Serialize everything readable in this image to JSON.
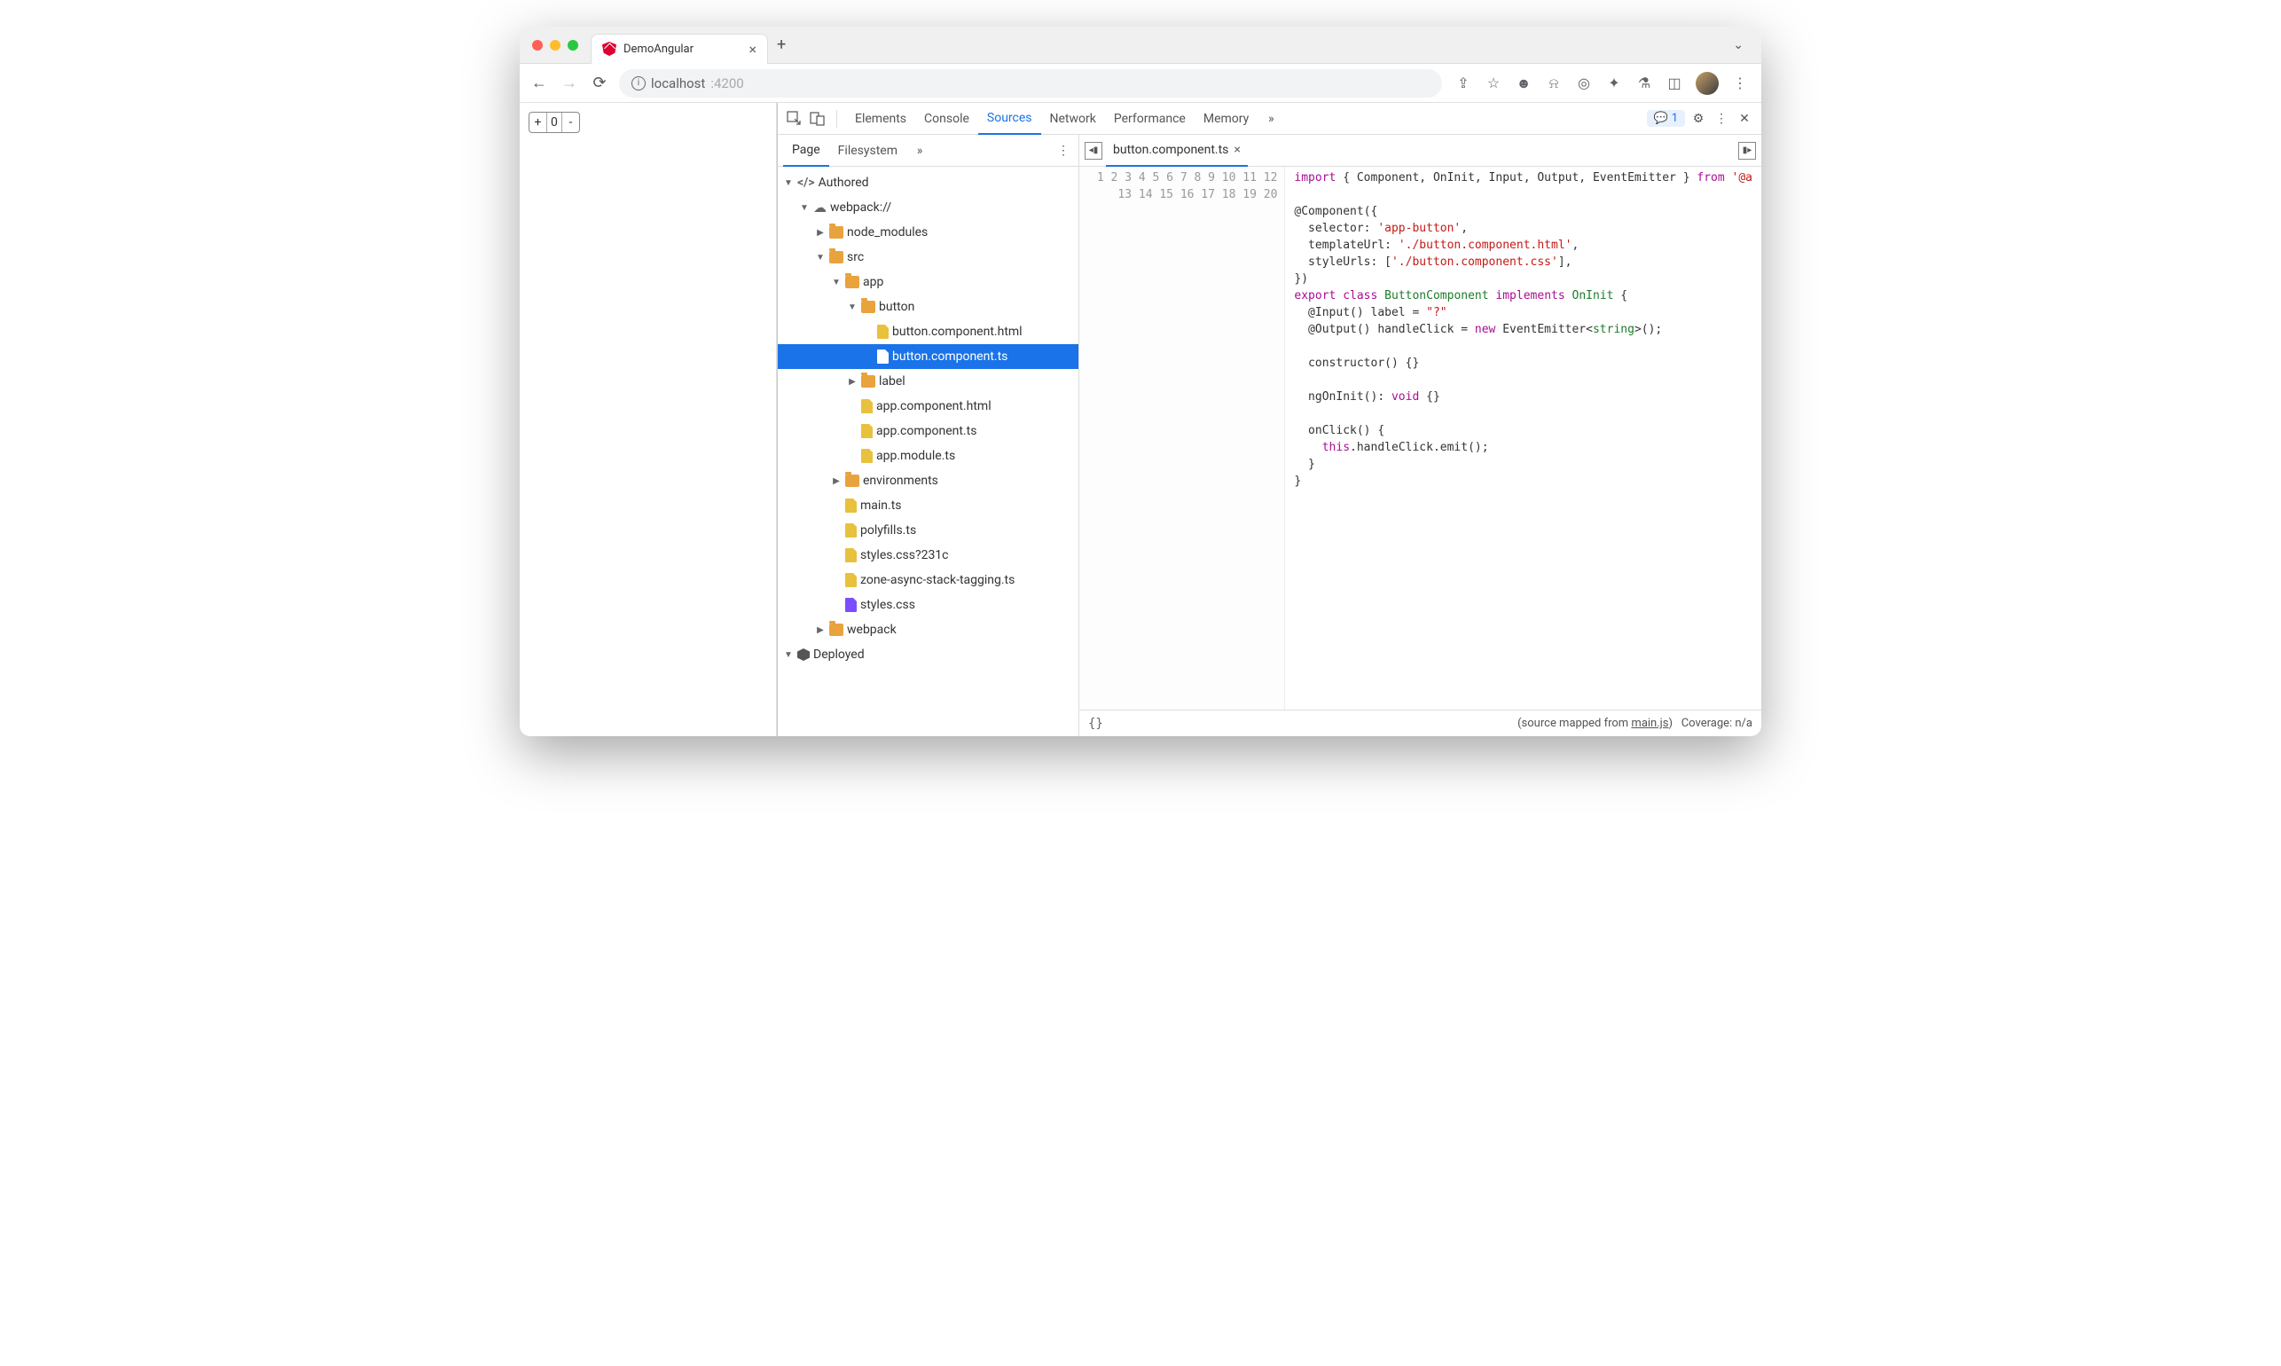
{
  "browser_tab": {
    "title": "DemoAngular",
    "url_host": "localhost",
    "url_port": ":4200"
  },
  "page_content": {
    "stepper_value": "0"
  },
  "devtools": {
    "panels": [
      "Elements",
      "Console",
      "Sources",
      "Network",
      "Performance",
      "Memory"
    ],
    "active_panel": "Sources",
    "issues_count": "1",
    "sources": {
      "nav_tabs": [
        "Page",
        "Filesystem"
      ],
      "active_nav": "Page",
      "tree": [
        {
          "depth": 0,
          "expand": "▼",
          "icon": "code",
          "label": "Authored"
        },
        {
          "depth": 1,
          "expand": "▼",
          "icon": "cloud",
          "label": "webpack://"
        },
        {
          "depth": 2,
          "expand": "▶",
          "icon": "folder",
          "label": "node_modules"
        },
        {
          "depth": 2,
          "expand": "▼",
          "icon": "folder",
          "label": "src"
        },
        {
          "depth": 3,
          "expand": "▼",
          "icon": "folder",
          "label": "app"
        },
        {
          "depth": 4,
          "expand": "▼",
          "icon": "folder",
          "label": "button"
        },
        {
          "depth": 5,
          "expand": "",
          "icon": "file",
          "label": "button.component.html"
        },
        {
          "depth": 5,
          "expand": "",
          "icon": "file",
          "label": "button.component.ts",
          "selected": true
        },
        {
          "depth": 4,
          "expand": "▶",
          "icon": "folder",
          "label": "label"
        },
        {
          "depth": 4,
          "expand": "",
          "icon": "file",
          "label": "app.component.html"
        },
        {
          "depth": 4,
          "expand": "",
          "icon": "file",
          "label": "app.component.ts"
        },
        {
          "depth": 4,
          "expand": "",
          "icon": "file",
          "label": "app.module.ts"
        },
        {
          "depth": 3,
          "expand": "▶",
          "icon": "folder",
          "label": "environments"
        },
        {
          "depth": 3,
          "expand": "",
          "icon": "file",
          "label": "main.ts"
        },
        {
          "depth": 3,
          "expand": "",
          "icon": "file",
          "label": "polyfills.ts"
        },
        {
          "depth": 3,
          "expand": "",
          "icon": "file",
          "label": "styles.css?231c"
        },
        {
          "depth": 3,
          "expand": "",
          "icon": "file",
          "label": "zone-async-stack-tagging.ts"
        },
        {
          "depth": 3,
          "expand": "",
          "icon": "file-css",
          "label": "styles.css"
        },
        {
          "depth": 2,
          "expand": "▶",
          "icon": "folder",
          "label": "webpack"
        },
        {
          "depth": 0,
          "expand": "▼",
          "icon": "cube",
          "label": "Deployed"
        }
      ]
    },
    "editor": {
      "open_file": "button.component.ts",
      "line_count": 20,
      "lines": [
        [
          {
            "t": "import",
            "c": "kw"
          },
          {
            "t": " { Component, OnInit, Input, Output, EventEmitter } "
          },
          {
            "t": "from",
            "c": "kw"
          },
          {
            "t": " "
          },
          {
            "t": "'@a",
            "c": "str"
          }
        ],
        [],
        [
          {
            "t": "@Component({"
          }
        ],
        [
          {
            "t": "  selector: "
          },
          {
            "t": "'app-button'",
            "c": "str"
          },
          {
            "t": ","
          }
        ],
        [
          {
            "t": "  templateUrl: "
          },
          {
            "t": "'./button.component.html'",
            "c": "str"
          },
          {
            "t": ","
          }
        ],
        [
          {
            "t": "  styleUrls: ["
          },
          {
            "t": "'./button.component.css'",
            "c": "str"
          },
          {
            "t": "],"
          }
        ],
        [
          {
            "t": "})"
          }
        ],
        [
          {
            "t": "export",
            "c": "kw"
          },
          {
            "t": " "
          },
          {
            "t": "class",
            "c": "kw"
          },
          {
            "t": " "
          },
          {
            "t": "ButtonComponent",
            "c": "cls"
          },
          {
            "t": " "
          },
          {
            "t": "implements",
            "c": "kw"
          },
          {
            "t": " "
          },
          {
            "t": "OnInit",
            "c": "cls"
          },
          {
            "t": " {"
          }
        ],
        [
          {
            "t": "  @Input() label = "
          },
          {
            "t": "\"?\"",
            "c": "str"
          }
        ],
        [
          {
            "t": "  @Output() handleClick = "
          },
          {
            "t": "new",
            "c": "kw"
          },
          {
            "t": " EventEmitter<"
          },
          {
            "t": "string",
            "c": "type"
          },
          {
            "t": ">();"
          }
        ],
        [],
        [
          {
            "t": "  constructor() {}"
          }
        ],
        [],
        [
          {
            "t": "  ngOnInit(): "
          },
          {
            "t": "void",
            "c": "kw"
          },
          {
            "t": " {}"
          }
        ],
        [],
        [
          {
            "t": "  onClick() {"
          }
        ],
        [
          {
            "t": "    "
          },
          {
            "t": "this",
            "c": "kw"
          },
          {
            "t": ".handleClick.emit();"
          }
        ],
        [
          {
            "t": "  }"
          }
        ],
        [
          {
            "t": "}"
          }
        ],
        []
      ],
      "status_braces": "{}",
      "source_mapped_prefix": "(source mapped from ",
      "source_mapped_link": "main.js",
      "source_mapped_suffix": ")",
      "coverage": "Coverage: n/a"
    }
  }
}
